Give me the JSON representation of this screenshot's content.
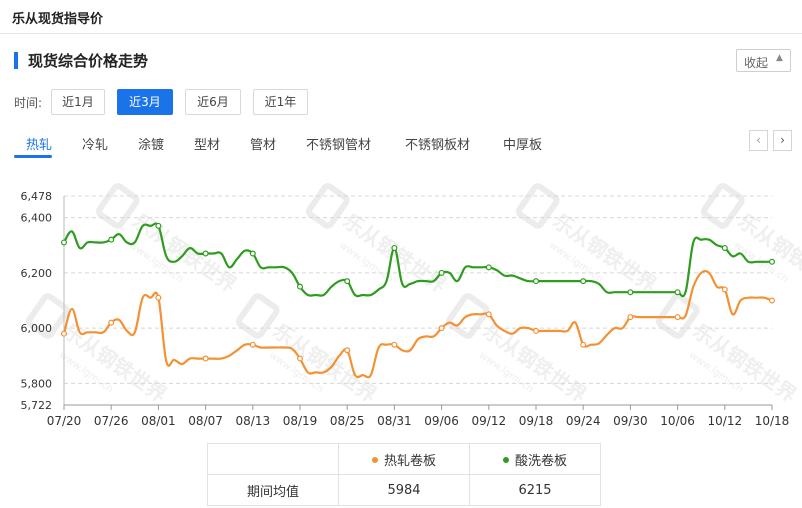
{
  "header": {
    "title": "乐从现货指导价"
  },
  "section": {
    "title": "现货综合价格走势",
    "collapse_label": "收起"
  },
  "time_filter": {
    "label": "时间:",
    "options": [
      "近1月",
      "近3月",
      "近6月",
      "近1年"
    ],
    "selected": "近3月"
  },
  "tabs": {
    "items": [
      "热轧",
      "冷轧",
      "涂镀",
      "型材",
      "管材",
      "不锈钢管材",
      "不锈钢板材",
      "中厚板"
    ],
    "selected": "热轧"
  },
  "watermark": {
    "text": "乐从钢铁世界",
    "url_text": "www.lgmi.cn"
  },
  "colors": {
    "accent": "#1a73e8",
    "series1": "#f39134",
    "series2": "#2e9c1e"
  },
  "chart_data": {
    "type": "line",
    "x": [
      "07/20",
      "07/21",
      "07/22",
      "07/23",
      "07/24",
      "07/25",
      "07/26",
      "07/27",
      "07/28",
      "07/29",
      "07/30",
      "07/31",
      "08/01",
      "08/02",
      "08/03",
      "08/04",
      "08/05",
      "08/06",
      "08/07",
      "08/08",
      "08/09",
      "08/10",
      "08/11",
      "08/12",
      "08/13",
      "08/14",
      "08/15",
      "08/16",
      "08/17",
      "08/18",
      "08/19",
      "08/20",
      "08/21",
      "08/22",
      "08/23",
      "08/24",
      "08/25",
      "08/26",
      "08/27",
      "08/28",
      "08/29",
      "08/30",
      "08/31",
      "09/01",
      "09/02",
      "09/03",
      "09/04",
      "09/05",
      "09/06",
      "09/07",
      "09/08",
      "09/09",
      "09/10",
      "09/11",
      "09/12",
      "09/13",
      "09/14",
      "09/15",
      "09/16",
      "09/17",
      "09/18",
      "09/19",
      "09/20",
      "09/21",
      "09/22",
      "09/23",
      "09/24",
      "09/25",
      "09/26",
      "09/27",
      "09/28",
      "09/29",
      "09/30",
      "10/01",
      "10/02",
      "10/03",
      "10/04",
      "10/05",
      "10/06",
      "10/07",
      "10/08",
      "10/09",
      "10/10",
      "10/11",
      "10/12",
      "10/13",
      "10/14",
      "10/15",
      "10/16",
      "10/17",
      "10/18"
    ],
    "xticks": [
      "07/20",
      "07/26",
      "08/01",
      "08/07",
      "08/13",
      "08/19",
      "08/25",
      "08/31",
      "09/06",
      "09/12",
      "09/18",
      "09/24",
      "09/30",
      "10/06",
      "10/12",
      "10/18"
    ],
    "yticks": [
      6478,
      6400,
      6200,
      6000,
      5800,
      5722
    ],
    "ylim": [
      5722,
      6478
    ],
    "grid": true,
    "series": [
      {
        "name": "热轧卷板",
        "color": "#f39134",
        "values": [
          5980,
          6070,
          5985,
          5985,
          5985,
          5985,
          6020,
          6030,
          5990,
          5985,
          6110,
          6110,
          6110,
          5880,
          5885,
          5870,
          5890,
          5890,
          5890,
          5890,
          5890,
          5900,
          5920,
          5940,
          5940,
          5930,
          5930,
          5930,
          5930,
          5925,
          5890,
          5840,
          5840,
          5840,
          5860,
          5900,
          5920,
          5830,
          5830,
          5830,
          5930,
          5940,
          5940,
          5920,
          5920,
          5960,
          5970,
          5970,
          6000,
          6020,
          6010,
          6040,
          6050,
          6050,
          6050,
          6010,
          5990,
          5980,
          6000,
          6000,
          5990,
          5990,
          5990,
          5990,
          5990,
          6020,
          5940,
          5940,
          5945,
          5975,
          6000,
          6000,
          6040,
          6040,
          6040,
          6040,
          6040,
          6040,
          6040,
          6045,
          6150,
          6200,
          6200,
          6150,
          6140,
          6050,
          6100,
          6110,
          6110,
          6110,
          6100
        ]
      },
      {
        "name": "酸洗卷板",
        "color": "#2e9c1e",
        "values": [
          6310,
          6350,
          6290,
          6310,
          6310,
          6310,
          6320,
          6340,
          6310,
          6310,
          6370,
          6370,
          6370,
          6260,
          6240,
          6260,
          6290,
          6270,
          6270,
          6270,
          6270,
          6220,
          6250,
          6280,
          6270,
          6220,
          6220,
          6220,
          6220,
          6200,
          6150,
          6120,
          6120,
          6120,
          6150,
          6170,
          6170,
          6120,
          6120,
          6120,
          6140,
          6170,
          6290,
          6160,
          6160,
          6170,
          6170,
          6170,
          6200,
          6200,
          6170,
          6220,
          6220,
          6220,
          6220,
          6210,
          6190,
          6190,
          6180,
          6170,
          6170,
          6170,
          6170,
          6170,
          6170,
          6170,
          6170,
          6170,
          6160,
          6130,
          6130,
          6130,
          6130,
          6130,
          6130,
          6130,
          6130,
          6130,
          6130,
          6130,
          6310,
          6320,
          6320,
          6300,
          6290,
          6260,
          6270,
          6240,
          6240,
          6240,
          6240
        ]
      }
    ]
  },
  "summary_table": {
    "row_label": "期间均值",
    "col1_name": "热轧卷板",
    "col2_name": "酸洗卷板",
    "col1_value": "5984",
    "col2_value": "6215"
  }
}
